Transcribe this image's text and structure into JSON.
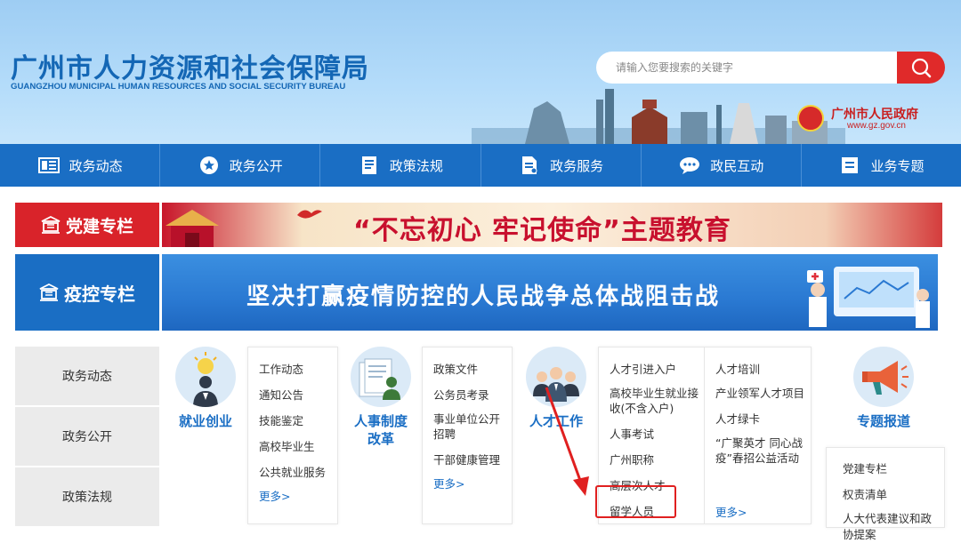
{
  "header": {
    "title": "广州市人力资源和社会保障局",
    "subtitle": "GUANGZHOU MUNICIPAL HUMAN RESOURCES AND SOCIAL SECURITY BUREAU",
    "search_placeholder": "请输入您要搜索的关键字",
    "gz_logo_name": "广州市人民政府",
    "gz_logo_url": "www.gz.gov.cn"
  },
  "nav": [
    {
      "label": "政务动态",
      "icon": "newspaper-icon"
    },
    {
      "label": "政务公开",
      "icon": "star-icon"
    },
    {
      "label": "政策法规",
      "icon": "document-icon"
    },
    {
      "label": "政务服务",
      "icon": "service-doc-icon"
    },
    {
      "label": "政民互动",
      "icon": "chat-icon"
    },
    {
      "label": "业务专题",
      "icon": "list-icon"
    }
  ],
  "banners": {
    "party_label": "党建专栏",
    "party_text": "“不忘初心  牢记使命”主题教育",
    "epidemic_label": "疫控专栏",
    "epidemic_text": "坚决打赢疫情防控的人民战争总体战阻击战"
  },
  "side_menu": [
    "政务动态",
    "政务公开",
    "政策法规"
  ],
  "categories": [
    {
      "label": "就业创业",
      "icon": "lightbulb-person-icon",
      "links": [
        "工作动态",
        "通知公告",
        "技能鉴定",
        "高校毕业生",
        "公共就业服务"
      ],
      "more": "更多>"
    },
    {
      "label": "人事制度改革",
      "icon": "documents-person-icon",
      "links": [
        "政策文件",
        "公务员考录",
        "事业单位公开招聘",
        "干部健康管理"
      ],
      "more": "更多>"
    },
    {
      "label": "人才工作",
      "icon": "team-icon",
      "links_col1": [
        "人才引进入户",
        "高校毕业生就业接收(不含入户)",
        "人事考试",
        "广州职称",
        "高层次人才",
        "留学人员"
      ],
      "links_col2": [
        "人才培训",
        "产业领军人才项目",
        "人才绿卡",
        "“广聚英才 同心战疫”春招公益活动"
      ],
      "more": "更多>"
    },
    {
      "label": "专题报道",
      "icon": "megaphone-icon",
      "links": [
        "党建专栏",
        "权责清单",
        "人大代表建议和政协提案"
      ]
    }
  ],
  "colors": {
    "brand_blue": "#1a6ec4",
    "party_red": "#d9232a",
    "highlight_red": "#e02020"
  }
}
